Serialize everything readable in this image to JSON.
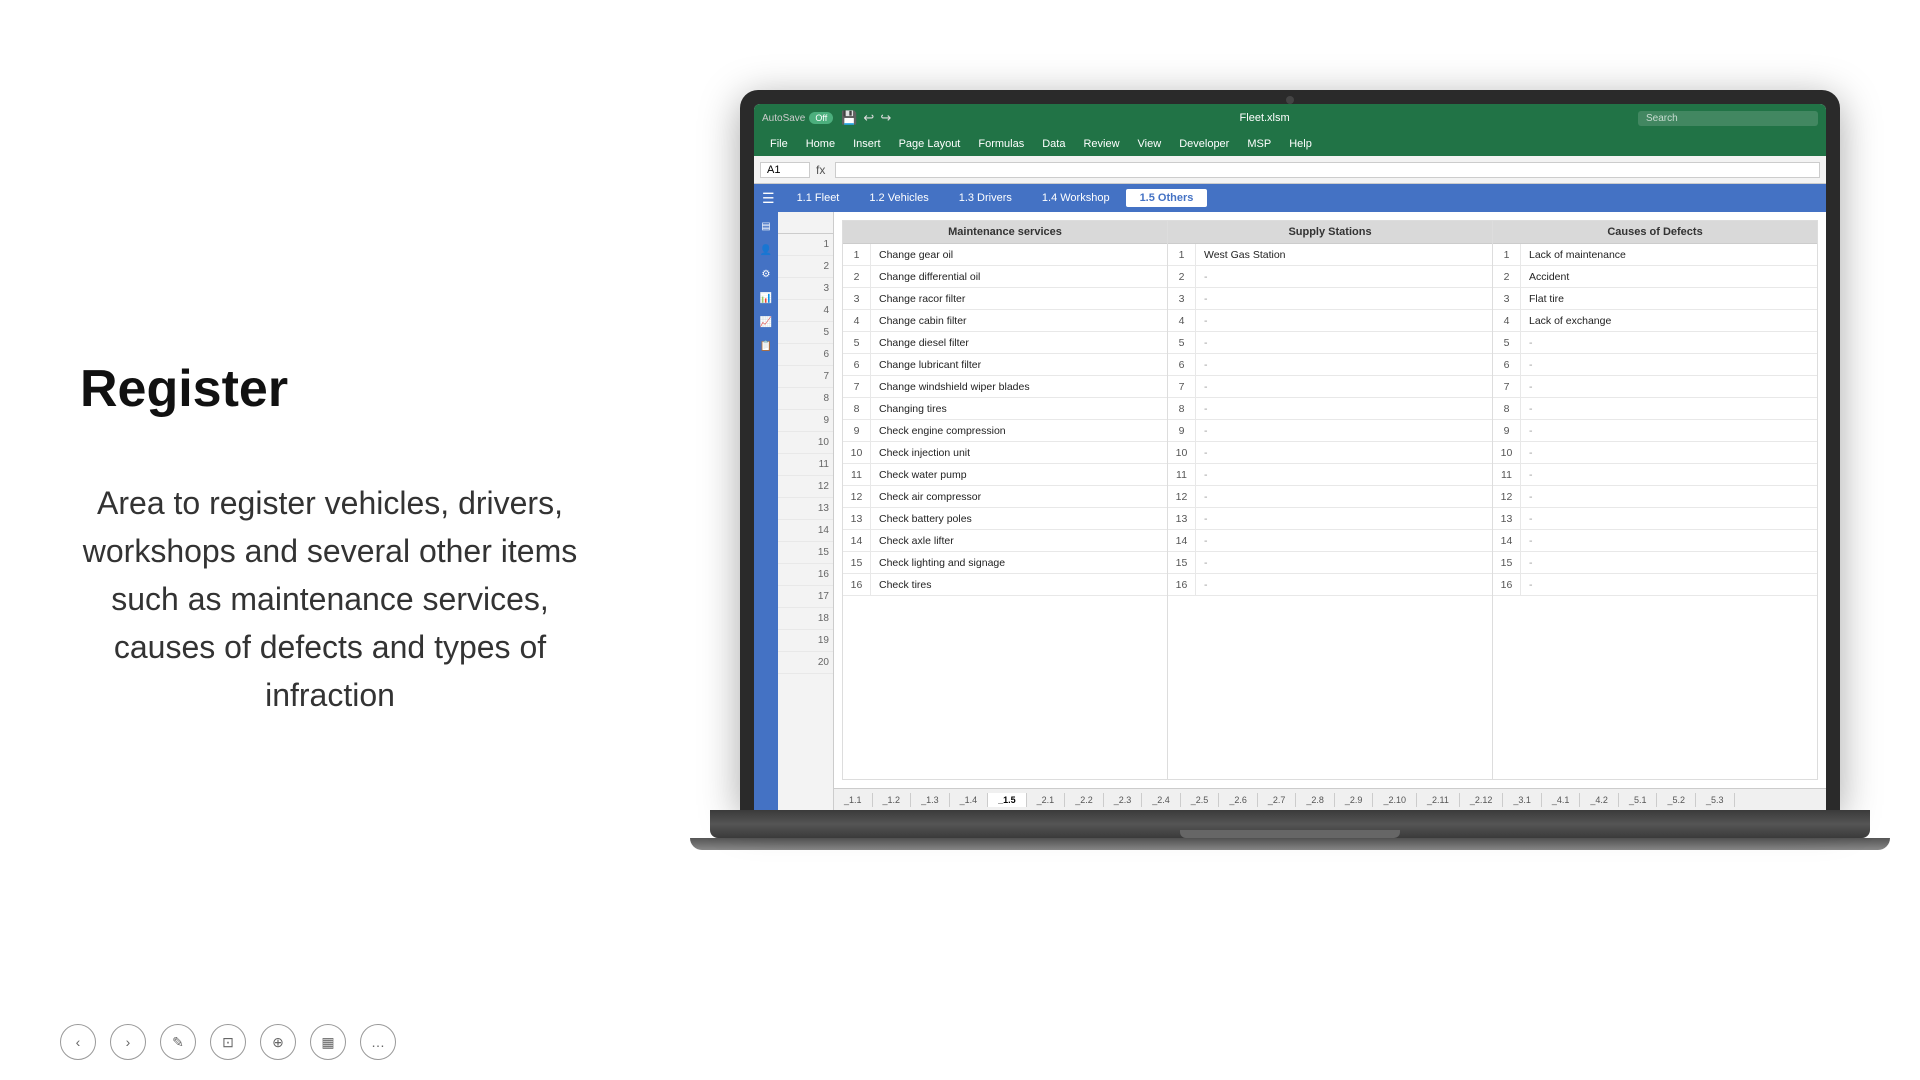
{
  "left": {
    "title": "Register",
    "description": "Area to register vehicles, drivers, workshops and several other items such as maintenance services, causes of defects and types of infraction"
  },
  "excel": {
    "titlebar": {
      "autosave_label": "AutoSave",
      "autosave_status": "Off",
      "filename": "Fleet.xlsm",
      "search_placeholder": "Search"
    },
    "menubar": {
      "items": [
        "File",
        "Home",
        "Insert",
        "Page Layout",
        "Formulas",
        "Data",
        "Review",
        "View",
        "Developer",
        "MSP",
        "Help"
      ]
    },
    "formula_bar": {
      "cell_ref": "A1",
      "formula": ""
    },
    "inner_tabs": {
      "tabs": [
        "1.1 Fleet",
        "1.2 Vehicles",
        "1.3 Drivers",
        "1.4 Workshop",
        "1.5 Others"
      ]
    },
    "sections": {
      "maintenance": {
        "header": "Maintenance services",
        "rows": [
          {
            "num": 1,
            "text": "Change gear oil"
          },
          {
            "num": 2,
            "text": "Change differential oil"
          },
          {
            "num": 3,
            "text": "Change racor filter"
          },
          {
            "num": 4,
            "text": "Change cabin filter"
          },
          {
            "num": 5,
            "text": "Change diesel filter"
          },
          {
            "num": 6,
            "text": "Change lubricant filter"
          },
          {
            "num": 7,
            "text": "Change windshield wiper blades"
          },
          {
            "num": 8,
            "text": "Changing tires"
          },
          {
            "num": 9,
            "text": "Check engine compression"
          },
          {
            "num": 10,
            "text": "Check injection unit"
          },
          {
            "num": 11,
            "text": "Check water pump"
          },
          {
            "num": 12,
            "text": "Check air compressor"
          },
          {
            "num": 13,
            "text": "Check battery poles"
          },
          {
            "num": 14,
            "text": "Check axle lifter"
          },
          {
            "num": 15,
            "text": "Check lighting and signage"
          },
          {
            "num": 16,
            "text": "Check tires"
          }
        ]
      },
      "supply": {
        "header": "Supply Stations",
        "rows": [
          {
            "num": 1,
            "text": "West Gas Station"
          },
          {
            "num": 2,
            "text": "-"
          },
          {
            "num": 3,
            "text": "-"
          },
          {
            "num": 4,
            "text": "-"
          },
          {
            "num": 5,
            "text": "-"
          },
          {
            "num": 6,
            "text": "-"
          },
          {
            "num": 7,
            "text": "-"
          },
          {
            "num": 8,
            "text": "-"
          },
          {
            "num": 9,
            "text": "-"
          },
          {
            "num": 10,
            "text": "-"
          },
          {
            "num": 11,
            "text": "-"
          },
          {
            "num": 12,
            "text": "-"
          },
          {
            "num": 13,
            "text": "-"
          },
          {
            "num": 14,
            "text": "-"
          },
          {
            "num": 15,
            "text": "-"
          },
          {
            "num": 16,
            "text": "-"
          }
        ]
      },
      "causes": {
        "header": "Causes of Defects",
        "rows": [
          {
            "num": 1,
            "text": "Lack of maintenance"
          },
          {
            "num": 2,
            "text": "Accident"
          },
          {
            "num": 3,
            "text": "Flat tire"
          },
          {
            "num": 4,
            "text": "Lack of exchange"
          },
          {
            "num": 5,
            "text": "-"
          },
          {
            "num": 6,
            "text": "-"
          },
          {
            "num": 7,
            "text": "-"
          },
          {
            "num": 8,
            "text": "-"
          },
          {
            "num": 9,
            "text": "-"
          },
          {
            "num": 10,
            "text": "-"
          },
          {
            "num": 11,
            "text": "-"
          },
          {
            "num": 12,
            "text": "-"
          },
          {
            "num": 13,
            "text": "-"
          },
          {
            "num": 14,
            "text": "-"
          },
          {
            "num": 15,
            "text": "-"
          },
          {
            "num": 16,
            "text": "-"
          }
        ]
      }
    },
    "bottom_tabs": [
      "_1.1",
      "_1.2",
      "_1.3",
      "_1.4",
      "_1.5",
      "_2.1",
      "_2.2",
      "_2.3",
      "_2.4",
      "_2.5",
      "_2.6",
      "_2.7",
      "_2.8",
      "_2.9",
      "_2.10",
      "_2.11",
      "_2.12",
      "_3.1",
      "_4.1",
      "_4.2",
      "_5.1",
      "_5.2",
      "_5.3"
    ]
  },
  "nav": {
    "prev_label": "‹",
    "next_label": "›",
    "edit_label": "✎",
    "copy_label": "⊡",
    "zoom_label": "⊕",
    "grid_label": "▦",
    "more_label": "…"
  }
}
